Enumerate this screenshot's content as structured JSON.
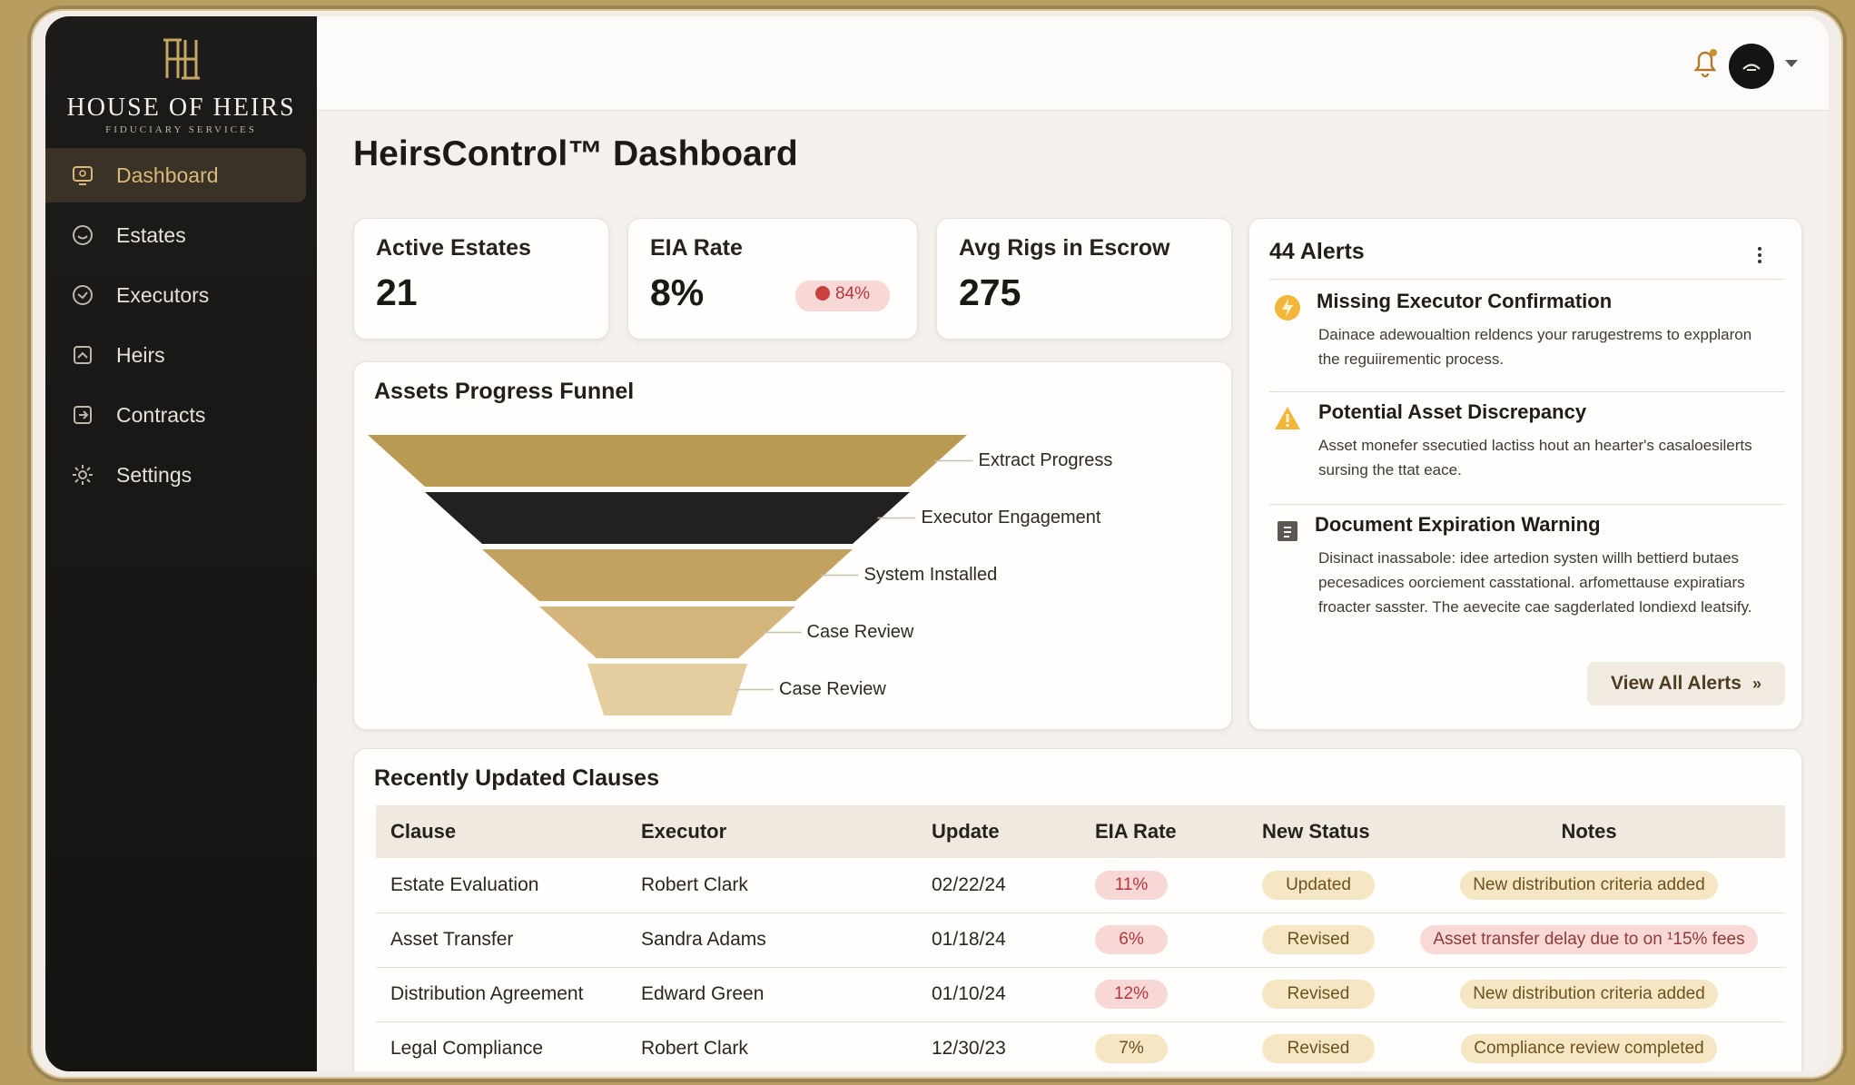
{
  "brand": {
    "name": "HOUSE OF HEIRS",
    "subtitle": "FIDUCIARY SERVICES",
    "mark": "HH monogram"
  },
  "sidebar": {
    "items": [
      {
        "label": "Dashboard",
        "icon": "monitor-icon",
        "active": true
      },
      {
        "label": "Estates",
        "icon": "estates-icon",
        "active": false
      },
      {
        "label": "Executors",
        "icon": "executors-icon",
        "active": false
      },
      {
        "label": "Heirs",
        "icon": "heirs-icon",
        "active": false
      },
      {
        "label": "Contracts",
        "icon": "contracts-icon",
        "active": false
      },
      {
        "label": "Settings",
        "icon": "gear-icon",
        "active": false
      }
    ]
  },
  "topbar": {
    "notification_icon": "bell-icon",
    "avatar_icon": "avatar-icon",
    "menu_icon": "chevron-down-icon"
  },
  "page": {
    "title": "HeirsControl™ Dashboard"
  },
  "stats": [
    {
      "label": "Active Estates",
      "value": "21"
    },
    {
      "label": "EIA Rate",
      "value": "8%",
      "badge": "84%"
    },
    {
      "label": "Avg Rigs in Escrow",
      "value": "275"
    }
  ],
  "funnel": {
    "title": "Assets Progress Funnel",
    "stages": [
      "Extract Progress",
      "Executor Engagement",
      "System Installed",
      "Case Review",
      "Case Review"
    ],
    "colors": [
      "#b89a52",
      "#232120",
      "#c3a261",
      "#d4b67c",
      "#e4cd9f"
    ]
  },
  "alerts": {
    "title": "44 Alerts",
    "items": [
      {
        "title": "Missing Executor Confirmation",
        "icon": "lightning-icon",
        "body": "Dainace adewoualtion reldencs your rarugestrems to expplaron the reguiirementic process."
      },
      {
        "title": "Potential Asset Discrepancy",
        "icon": "warning-icon",
        "body": "Asset monefer ssecutied lactiss hout an hearter's casaloesilerts sursing the ttat eace."
      },
      {
        "title": "Document Expiration Warning",
        "icon": "document-icon",
        "body": "Disinact inassabole: idee artedion systen willh bettierd butaes pecesadices oorciement casstational. arfomettause expiratiars froacter sasster. The aevecite cae sagderlated londiexd leatsify."
      }
    ],
    "view_all": "View All Alerts"
  },
  "clauses": {
    "title": "Recently Updated Clauses",
    "columns": [
      "Clause",
      "Executor",
      "Update",
      "EIA Rate",
      "New Status",
      "Notes"
    ],
    "rows": [
      {
        "clause": "Estate Evaluation",
        "executor": "Robert Clark",
        "update": "02/22/24",
        "eia": "11%",
        "status": "Updated",
        "notes": "New distribution criteria added"
      },
      {
        "clause": "Asset Transfer",
        "executor": "Sandra Adams",
        "update": "01/18/24",
        "eia": "6%",
        "status": "Revised",
        "notes": "Asset transfer delay due to on ¹15% fees"
      },
      {
        "clause": "Distribution Agreement",
        "executor": "Edward Green",
        "update": "01/10/24",
        "eia": "12%",
        "status": "Revised",
        "notes": "New distribution criteria added"
      },
      {
        "clause": "Legal Compliance",
        "executor": "Robert Clark",
        "update": "12/30/23",
        "eia": "7%",
        "status": "Revised",
        "notes": "Compliance review completed"
      }
    ]
  }
}
